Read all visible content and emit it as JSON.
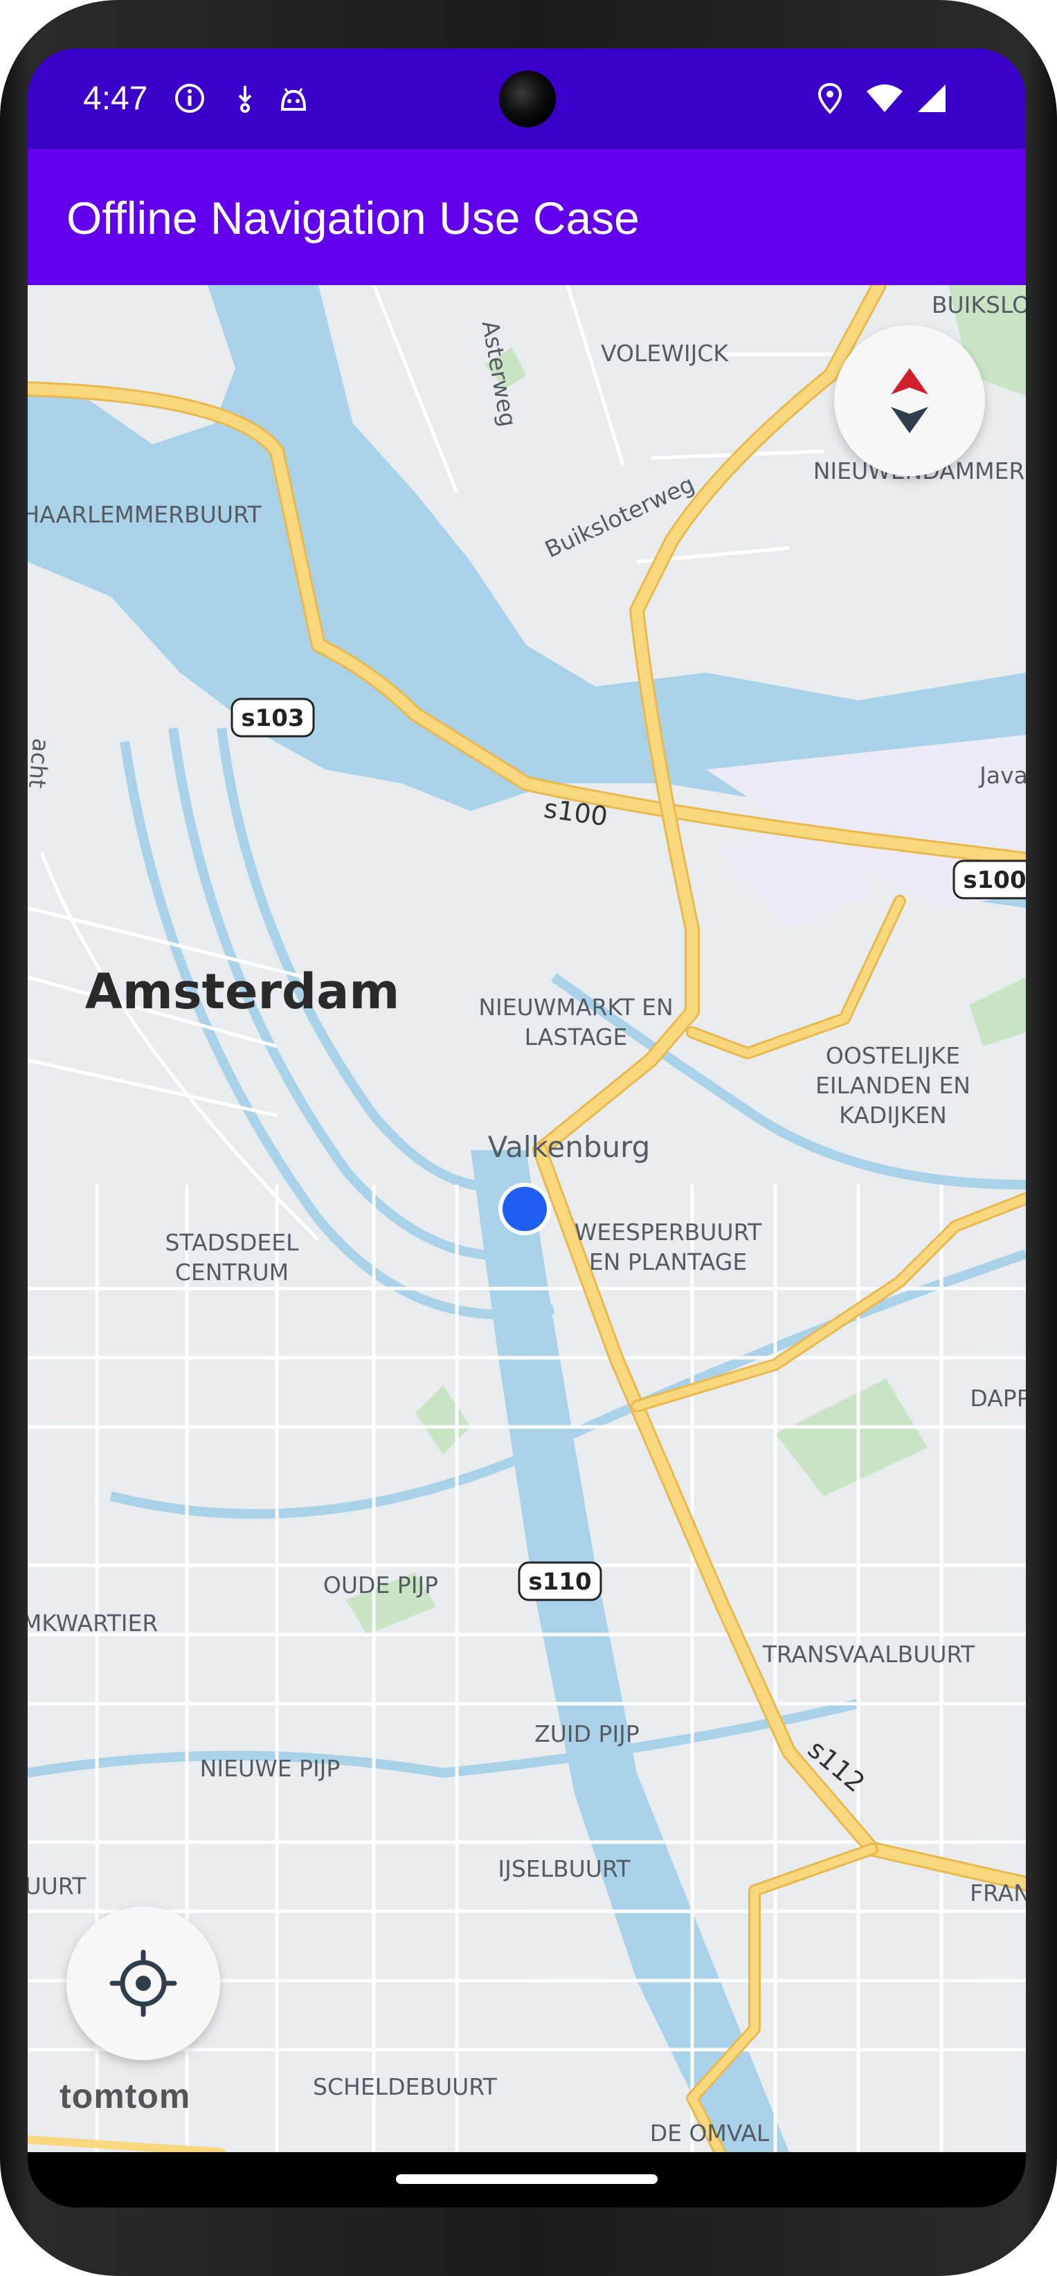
{
  "status_bar": {
    "time": "4:47",
    "icons_left": [
      "info-icon",
      "download-icon",
      "android-debug-icon"
    ],
    "icons_right": [
      "location-icon",
      "wifi-icon",
      "cellular-signal-icon"
    ]
  },
  "app_bar": {
    "title": "Offline Navigation Use Case"
  },
  "map": {
    "labels": {
      "buiksloot": "BUIKSLOO",
      "asterweg": "Asterweg",
      "volewijck": "VOLEWIJCK",
      "buiksloterweg": "Buiksloterweg",
      "nieuwendammer": "NIEUWENDAMMERH",
      "haarlemmerbuurt": "HAARLEMMERBUURT",
      "gracht": "acht",
      "java": "Java",
      "amsterdam": "Amsterdam",
      "nieuwmarkt_1": "NIEUWMARKT EN",
      "nieuwmarkt_2": "LASTAGE",
      "oostelijke_1": "OOSTELIJKE",
      "oostelijke_2": "EILANDEN EN",
      "oostelijke_3": "KADIJKEN",
      "valkenburg": "Valkenburg",
      "weesperbuurt_1": "WEESPERBUURT",
      "weesperbuurt_2": "EN PLANTAGE",
      "stadsdeel_1": "STADSDEEL",
      "stadsdeel_2": "CENTRUM",
      "dapp": "DAPP",
      "oude_pijp": "OUDE PIJP",
      "museumkwartier": "MKWARTIER",
      "transvaalbuurt": "TRANSVAALBUURT",
      "zuid_pijp": "ZUID PIJP",
      "nieuwe_pijp": "NIEUWE PIJP",
      "ijselbuurt": "IJSELBUURT",
      "uurt": "UURT",
      "frans": "FRAN",
      "scheldebuurt": "SCHELDEBUURT",
      "de_omval": "DE OMVAL",
      "s100_road": "s100",
      "s112_road": "s112"
    },
    "shields": {
      "s103": "s103",
      "s100": "s100",
      "s110": "s110"
    },
    "colors": {
      "water": "#a9d2e8",
      "land": "#e9ecef",
      "main_road": "#f9d77d",
      "road_casing": "#e8b94f",
      "park": "#c9e4c5",
      "location_dot": "#1f5ef0"
    },
    "logo": "tomtom"
  },
  "controls": {
    "compass": "compass-icon",
    "locate": "crosshair-icon"
  }
}
